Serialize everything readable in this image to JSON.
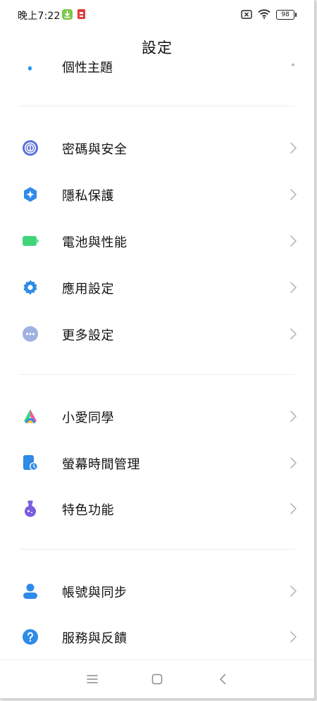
{
  "status_bar": {
    "time": "晚上7:22",
    "battery": "98",
    "icons": [
      "download-notification-icon",
      "app-notification-icon",
      "sim-off-icon",
      "wifi-icon",
      "battery-icon"
    ]
  },
  "header": {
    "title": "設定"
  },
  "partial_item": {
    "label": "個性主題"
  },
  "groups": [
    {
      "items": [
        {
          "label": "密碼與安全",
          "icon": "fingerprint-icon",
          "color": "#5b6fd6"
        },
        {
          "label": "隱私保護",
          "icon": "privacy-shield-icon",
          "color": "#2e8be8"
        },
        {
          "label": "電池與性能",
          "icon": "battery-icon",
          "color": "#3fd67a"
        },
        {
          "label": "應用設定",
          "icon": "gear-icon",
          "color": "#2e8be8"
        },
        {
          "label": "更多設定",
          "icon": "more-dots-icon",
          "color": "#9fb1e0"
        }
      ]
    },
    {
      "items": [
        {
          "label": "小愛同學",
          "icon": "xiaoai-icon",
          "color": "#3fd67a"
        },
        {
          "label": "螢幕時間管理",
          "icon": "screen-time-icon",
          "color": "#2e8be8"
        },
        {
          "label": "特色功能",
          "icon": "flask-icon",
          "color": "#7b5ce0"
        }
      ]
    },
    {
      "items": [
        {
          "label": "帳號與同步",
          "icon": "account-icon",
          "color": "#2e8be8"
        },
        {
          "label": "服務與反饋",
          "icon": "help-icon",
          "color": "#2e8be8"
        }
      ]
    }
  ],
  "nav_bar": {
    "buttons": [
      "menu-icon",
      "home-icon",
      "back-icon"
    ]
  }
}
